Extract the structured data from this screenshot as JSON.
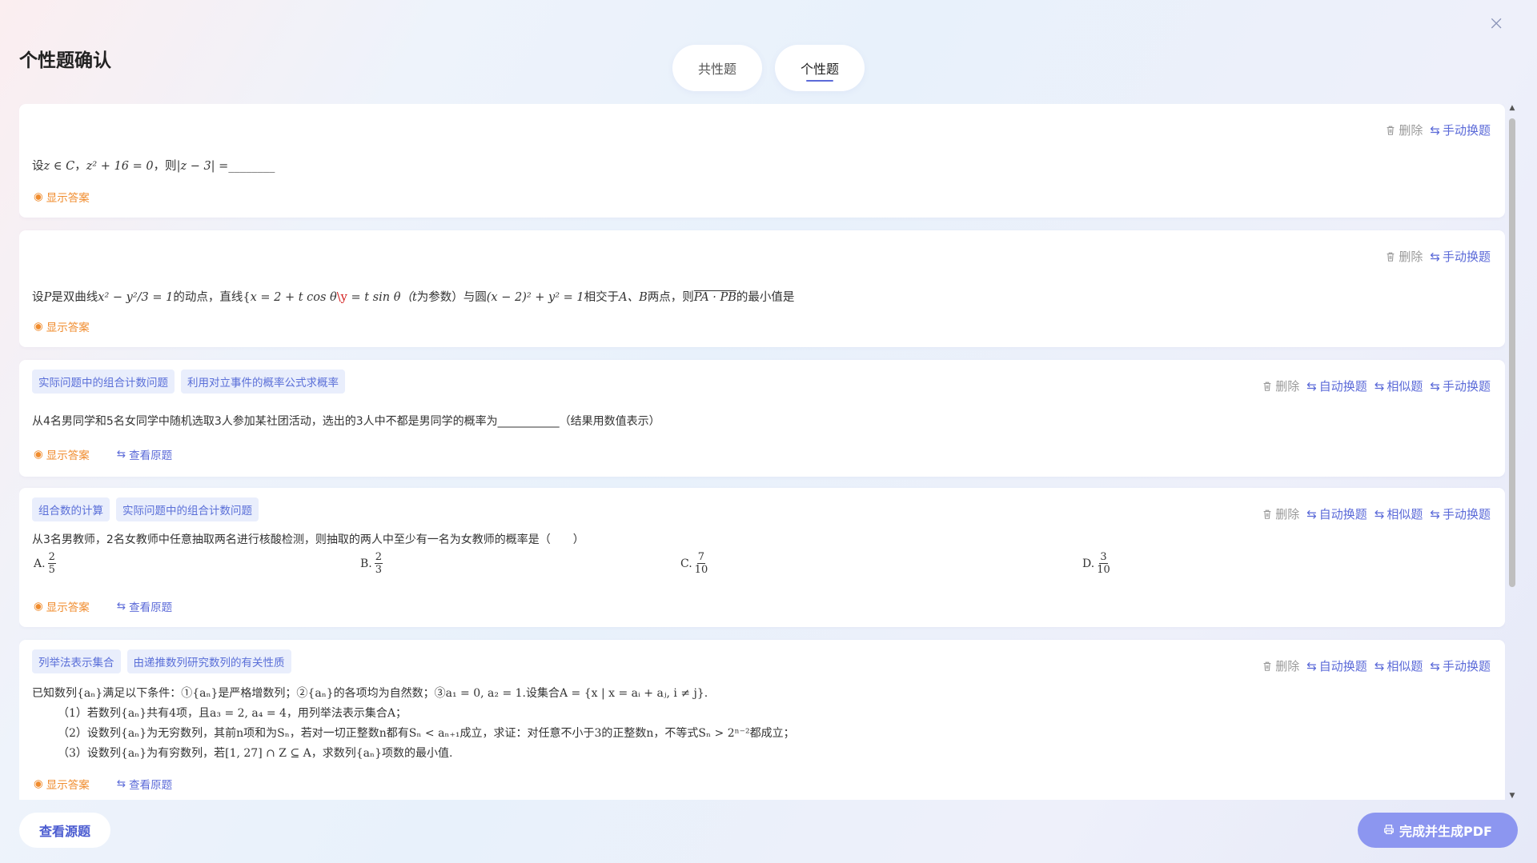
{
  "page_title": "个性题确认",
  "tabs": [
    {
      "label": "共性题"
    },
    {
      "label": "个性题"
    }
  ],
  "actions": {
    "delete": "删除",
    "auto_replace": "自动换题",
    "similar": "相似题",
    "manual_replace": "手动换题"
  },
  "footer_links": {
    "show_answer": "显示答案",
    "view_original": "查看原题"
  },
  "questions": [
    {
      "tags": [],
      "text_pre": "设",
      "text_math1": "z ∈ C",
      "text_sep1": "，",
      "text_math2": "z² + 16 = 0",
      "text_sep2": "，则",
      "text_math3": "|z − 3| =",
      "text_blank": "________"
    },
    {
      "tags": [],
      "text_a": "设",
      "text_b": "P",
      "text_c": "是双曲线",
      "text_d": "x² − y²/3 = 1",
      "text_e": "的动点，直线{",
      "text_f": "x = 2 + t cos θ",
      "text_g": "\\y",
      "text_h": " = t sin θ（",
      "text_i": "t",
      "text_j": "为参数）与圆",
      "text_k": "(x − 2)² + y² = 1",
      "text_l": "相交于",
      "text_m": "A、B",
      "text_n": "两点，则",
      "text_o": "PA · PB",
      "text_p": "的最小值是"
    },
    {
      "tags": [
        "实际问题中的组合计数问题",
        "利用对立事件的概率公式求概率"
      ],
      "text": "从4名男同学和5名女同学中随机选取3人参加某社团活动，选出的3人中不都是男同学的概率为___________（结果用数值表示）"
    },
    {
      "tags": [
        "组合数的计算",
        "实际问题中的组合计数问题"
      ],
      "text": "从3名男教师，2名女教师中任意抽取两名进行核酸检测，则抽取的两人中至少有一名为女教师的概率是（　　）",
      "options": [
        {
          "label": "A.",
          "num": "2",
          "den": "5"
        },
        {
          "label": "B.",
          "num": "2",
          "den": "3"
        },
        {
          "label": "C.",
          "num": "7",
          "den": "10"
        },
        {
          "label": "D.",
          "num": "3",
          "den": "10"
        }
      ]
    },
    {
      "tags": [
        "列举法表示集合",
        "由递推数列研究数列的有关性质"
      ],
      "text": "已知数列{aₙ}满足以下条件：①{aₙ}是严格增数列；②{aₙ}的各项均为自然数；③a₁ = 0, a₂ = 1.设集合A = {x | x = aᵢ + aⱼ, i ≠ j}.",
      "subs": [
        "（1）若数列{aₙ}共有4项，且a₃ = 2, a₄ = 4，用列举法表示集合A；",
        "（2）设数列{aₙ}为无穷数列，其前n项和为Sₙ，若对一切正整数n都有Sₙ < aₙ₊₁成立，求证：对任意不小于3的正整数n，不等式Sₙ > 2ⁿ⁻²都成立；",
        "（3）设数列{aₙ}为有穷数列，若[1, 27] ∩ Z ⊆ A，求数列{aₙ}项数的最小值."
      ]
    }
  ],
  "bottom": {
    "view_source": "查看源题",
    "finish_pdf": "完成并生成PDF"
  },
  "colors": {
    "accent": "#5b6ad8",
    "answer_orange": "#f08c2e",
    "tag_bg": "#e9eefc",
    "pdf_button": "#8c96f0"
  }
}
